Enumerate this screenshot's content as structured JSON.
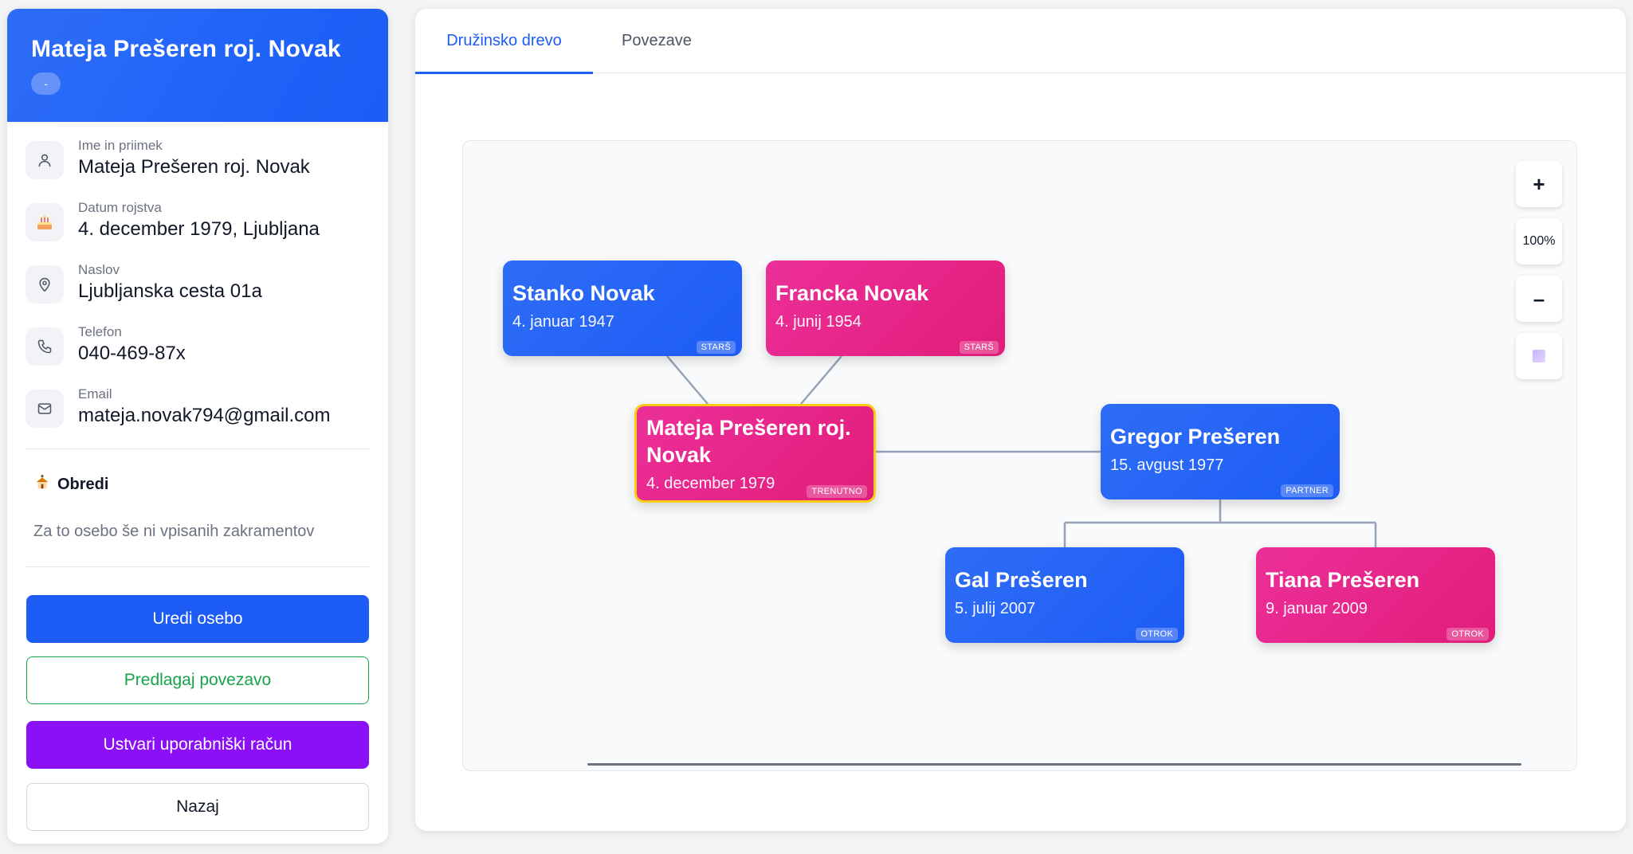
{
  "profile": {
    "name": "Mateja Prešeren roj. Novak",
    "badge": "-",
    "fields": [
      {
        "icon": "user-icon",
        "label": "Ime in priimek",
        "value": "Mateja Prešeren roj. Novak"
      },
      {
        "icon": "birthday-cake-icon",
        "label": "Datum rojstva",
        "value": "4. december 1979, Ljubljana"
      },
      {
        "icon": "location-pin-icon",
        "label": "Naslov",
        "value": "Ljubljanska cesta 01a"
      },
      {
        "icon": "phone-icon",
        "label": "Telefon",
        "value": "040-469-87x"
      },
      {
        "icon": "mail-icon",
        "label": "Email",
        "value": "mateja.novak794@gmail.com"
      }
    ],
    "rites": {
      "icon": "church-icon",
      "title": "Obredi",
      "empty_text": "Za to osebo še ni vpisanih zakramentov"
    },
    "buttons": {
      "edit": "Uredi osebo",
      "suggest": "Predlagaj povezavo",
      "create_account": "Ustvari uporabniški račun",
      "back": "Nazaj"
    }
  },
  "tabs": [
    {
      "label": "Družinsko drevo",
      "active": true
    },
    {
      "label": "Povezave",
      "active": false
    }
  ],
  "tree": {
    "nodes": [
      {
        "id": "stanko",
        "name": "Stanko Novak",
        "date": "4. januar 1947",
        "role": "STARŠ",
        "gender": "male"
      },
      {
        "id": "francka",
        "name": "Francka Novak",
        "date": "4. junij 1954",
        "role": "STARŠ",
        "gender": "female"
      },
      {
        "id": "mateja",
        "name": "Mateja Prešeren roj. Novak",
        "date": "4. december 1979",
        "role": "TRENUTNO",
        "gender": "female"
      },
      {
        "id": "gregor",
        "name": "Gregor Prešeren",
        "date": "15. avgust 1977",
        "role": "PARTNER",
        "gender": "male"
      },
      {
        "id": "gal",
        "name": "Gal Prešeren",
        "date": "5. julij 2007",
        "role": "OTROK",
        "gender": "male"
      },
      {
        "id": "tiana",
        "name": "Tiana Prešeren",
        "date": "9. januar 2009",
        "role": "OTROK",
        "gender": "female"
      }
    ],
    "zoom": {
      "zoom_in": "+",
      "level": "100%",
      "zoom_out": "–"
    },
    "colors": {
      "male": "#1d5cf5",
      "female": "#e11d7a",
      "current_border": "#facc15",
      "connector": "#94a3b8"
    }
  }
}
